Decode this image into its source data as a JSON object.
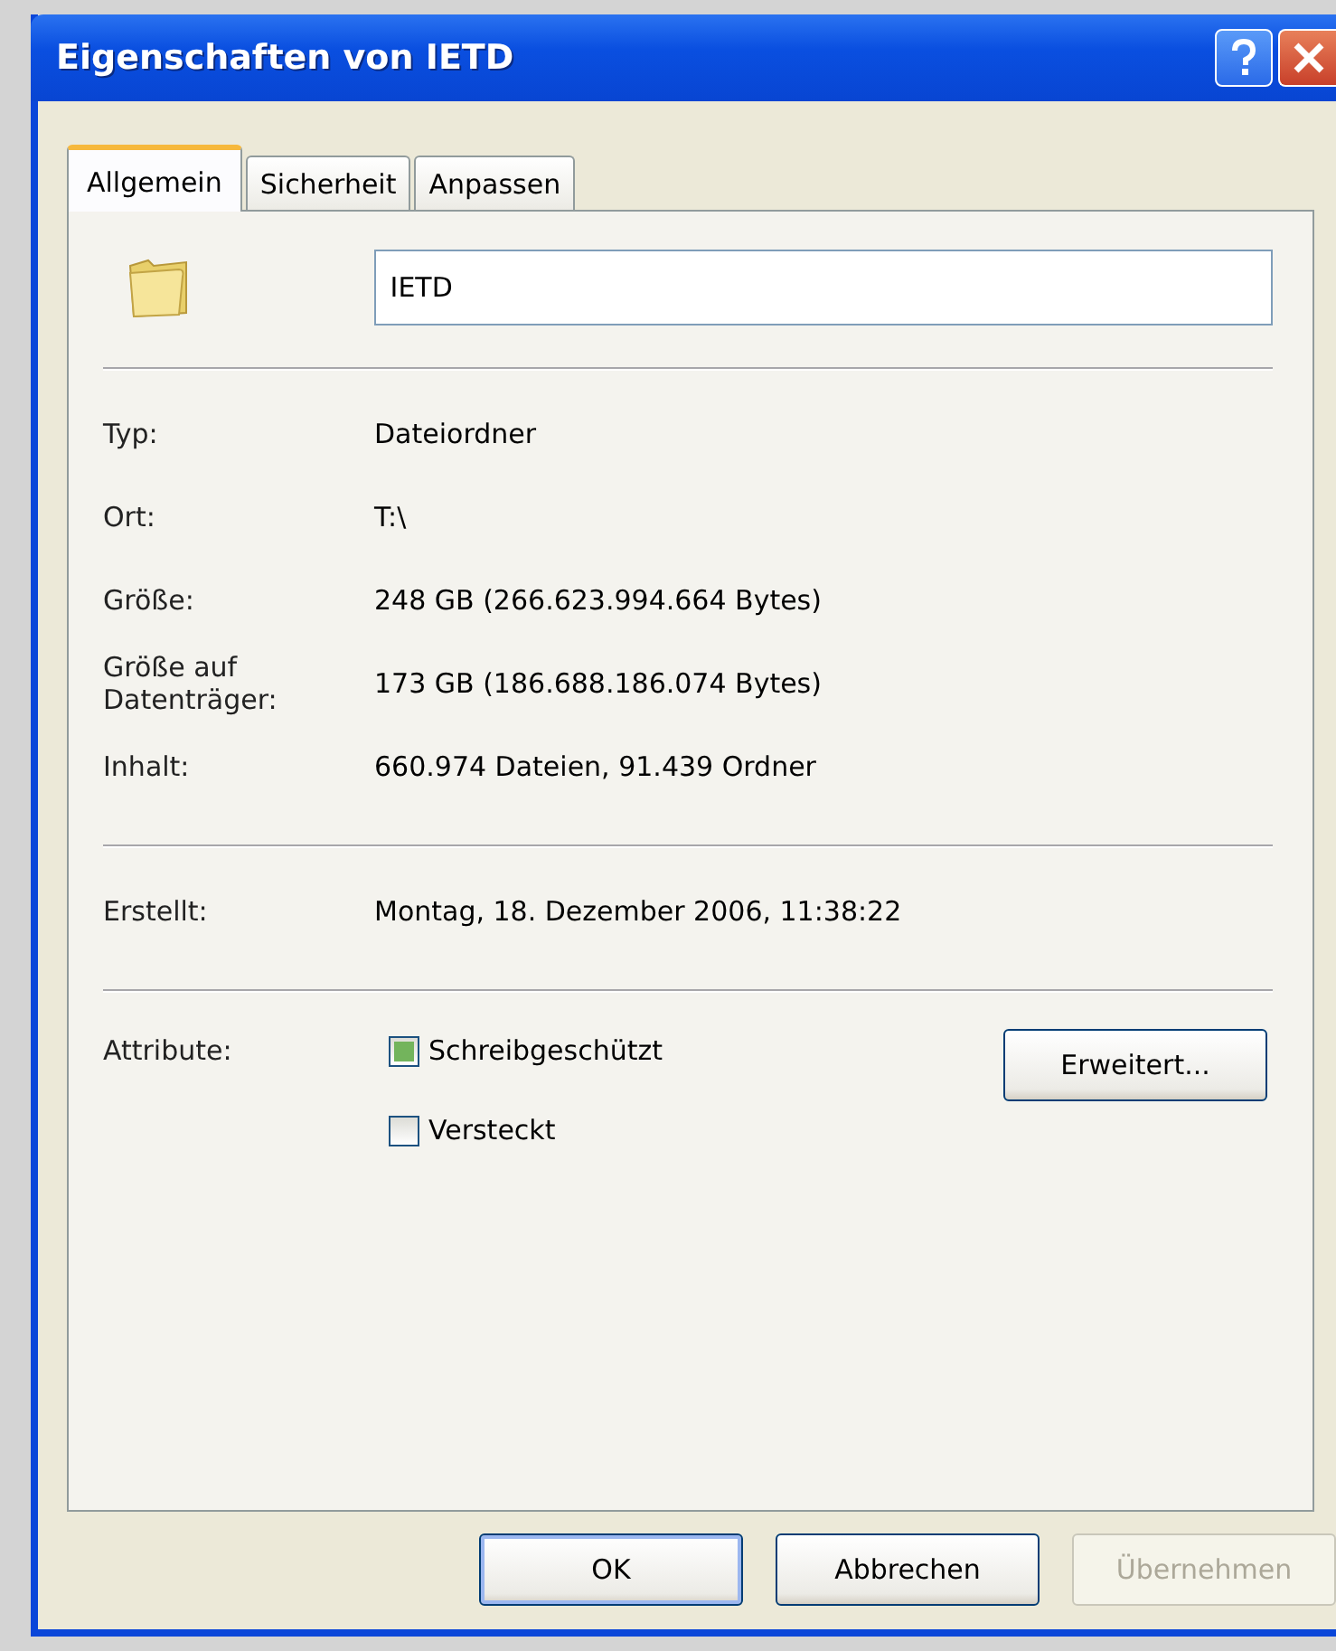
{
  "window": {
    "title": "Eigenschaften von IETD"
  },
  "tabs": [
    {
      "label": "Allgemein",
      "selected": true
    },
    {
      "label": "Sicherheit",
      "selected": false
    },
    {
      "label": "Anpassen",
      "selected": false
    }
  ],
  "name_field": {
    "value": "IETD"
  },
  "groups": [
    [
      {
        "label": "Typ:",
        "value": "Dateiordner"
      },
      {
        "label": "Ort:",
        "value": "T:\\"
      },
      {
        "label": "Größe:",
        "value": "248 GB (266.623.994.664 Bytes)"
      },
      {
        "label": "Größe auf Datenträger:",
        "value": "173 GB (186.688.186.074 Bytes)"
      },
      {
        "label": "Inhalt:",
        "value": "660.974 Dateien, 91.439 Ordner"
      }
    ],
    [
      {
        "label": "Erstellt:",
        "value": "Montag, 18. Dezember 2006, 11:38:22"
      }
    ]
  ],
  "attributes": {
    "label": "Attribute:",
    "items": [
      {
        "label": "Schreibgeschützt",
        "indeterminate": true
      },
      {
        "label": "Versteckt",
        "indeterminate": false
      }
    ],
    "advanced_button": "Erweitert..."
  },
  "buttons": [
    {
      "label": "OK",
      "default": true,
      "disabled": false
    },
    {
      "label": "Abbrechen",
      "default": false,
      "disabled": false
    },
    {
      "label": "Übernehmen",
      "default": false,
      "disabled": true
    }
  ]
}
